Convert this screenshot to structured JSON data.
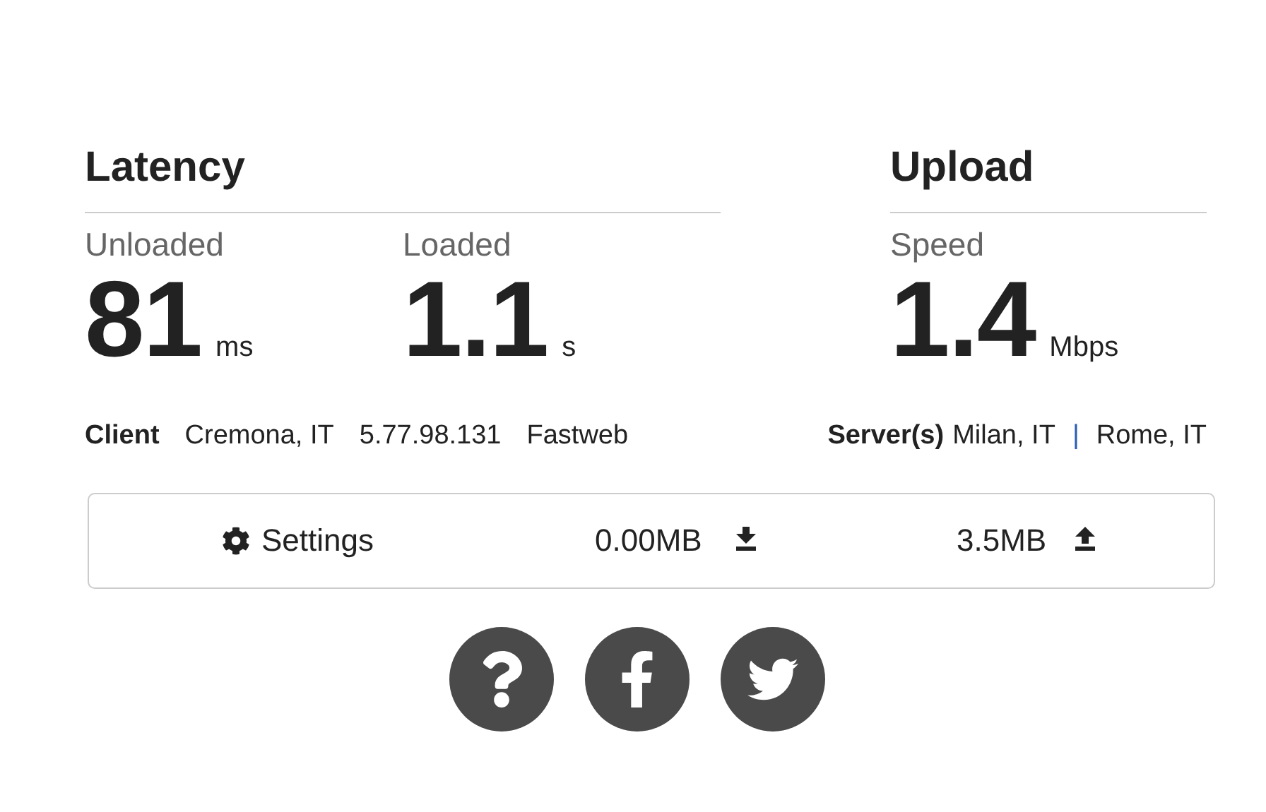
{
  "latency": {
    "title": "Latency",
    "metrics": [
      {
        "label": "Unloaded",
        "value": "81",
        "unit": "ms"
      },
      {
        "label": "Loaded",
        "value": "1.1",
        "unit": "s"
      }
    ]
  },
  "upload": {
    "title": "Upload",
    "metrics": [
      {
        "label": "Speed",
        "value": "1.4",
        "unit": "Mbps"
      }
    ]
  },
  "client": {
    "label": "Client",
    "location": "Cremona, IT",
    "ip": "5.77.98.131",
    "isp": "Fastweb"
  },
  "servers": {
    "label": "Server(s)",
    "items": [
      "Milan, IT",
      "Rome, IT"
    ],
    "separator": "|"
  },
  "toolbar": {
    "settings": "Settings",
    "downloaded": "0.00MB",
    "uploaded": "3.5MB"
  },
  "social": [
    {
      "kind": "help"
    },
    {
      "kind": "facebook"
    },
    {
      "kind": "twitter"
    }
  ]
}
